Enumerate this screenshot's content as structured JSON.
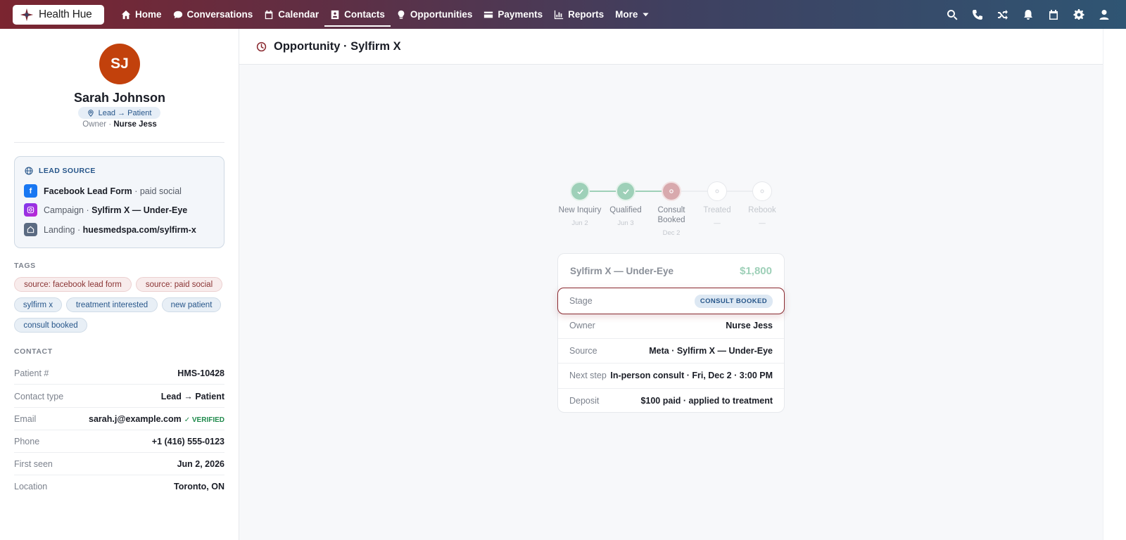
{
  "brand": {
    "name": "Health Hue"
  },
  "nav": {
    "items": [
      {
        "label": "Home",
        "icon": "home-icon"
      },
      {
        "label": "Conversations",
        "icon": "chat-icon"
      },
      {
        "label": "Calendar",
        "icon": "calendar-icon"
      },
      {
        "label": "Contacts",
        "icon": "contact-card-icon",
        "active": true
      },
      {
        "label": "Opportunities",
        "icon": "lightbulb-icon"
      },
      {
        "label": "Payments",
        "icon": "credit-card-icon"
      },
      {
        "label": "Reports",
        "icon": "bar-chart-icon"
      },
      {
        "label": "More",
        "icon": "caret-down-icon"
      }
    ],
    "right_icons": [
      "search-icon",
      "phone-icon",
      "shuffle-icon",
      "bell-icon",
      "calendar-icon",
      "gear-icon",
      "user-icon"
    ]
  },
  "contact": {
    "initials": "SJ",
    "name": "Sarah Johnson",
    "status": "Lead → Patient",
    "owner_label": "Owner ·",
    "owner": "Nurse Jess"
  },
  "lead_source": {
    "title": "LEAD SOURCE",
    "form": "Facebook Lead Form",
    "form_suffix": "· paid social",
    "campaign_label": "Campaign ·",
    "campaign": "Sylfirm X — Under-Eye",
    "landing_label": "Landing ·",
    "landing": "huesmedspa.com/sylfirm-x"
  },
  "tags": {
    "title": "TAGS",
    "items": [
      "source: facebook lead form",
      "source: paid social",
      "sylfirm x",
      "treatment interested",
      "new patient",
      "consult booked"
    ]
  },
  "contact_info": {
    "title": "CONTACT",
    "rows": [
      {
        "k": "Patient #",
        "v": "HMS-10428"
      },
      {
        "k": "Contact type",
        "v": "Lead → Patient"
      },
      {
        "k": "Email",
        "v": "sarah.j@example.com",
        "badge": "✓ VERIFIED"
      },
      {
        "k": "Phone",
        "v": "+1 (416) 555-0123"
      },
      {
        "k": "First seen",
        "v": "Jun 2, 2026"
      },
      {
        "k": "Location",
        "v": "Toronto, ON"
      }
    ]
  },
  "opportunity": {
    "header": "Opportunity · Sylfirm X",
    "stages": [
      {
        "label": "New Inquiry",
        "date": "Jun 2",
        "state": "done"
      },
      {
        "label": "Qualified",
        "date": "Jun 3",
        "state": "done"
      },
      {
        "label": "Consult Booked",
        "date": "Dec 2",
        "state": "current"
      },
      {
        "label": "Treated",
        "date": "—",
        "state": "todo"
      },
      {
        "label": "Rebook",
        "date": "—",
        "state": "todo"
      }
    ],
    "card": {
      "title": "Sylfirm X — Under-Eye",
      "price": "$1,800",
      "stage_label": "Stage",
      "stage_value": "CONSULT BOOKED",
      "rows": [
        {
          "k": "Owner",
          "v": "Nurse Jess"
        },
        {
          "k": "Source",
          "v": "Meta · Sylfirm X — Under-Eye"
        },
        {
          "k": "Next step",
          "v": "In-person consult · Fri, Dec 2 · 3:00 PM"
        },
        {
          "k": "Deposit",
          "v": "$100 paid · applied to treatment"
        }
      ]
    }
  },
  "colors": {
    "accent": "#8a2a30",
    "avatar": "#c2410c",
    "done": "#9ed0b8",
    "current": "#d8a9ad",
    "link": "#27568a"
  }
}
